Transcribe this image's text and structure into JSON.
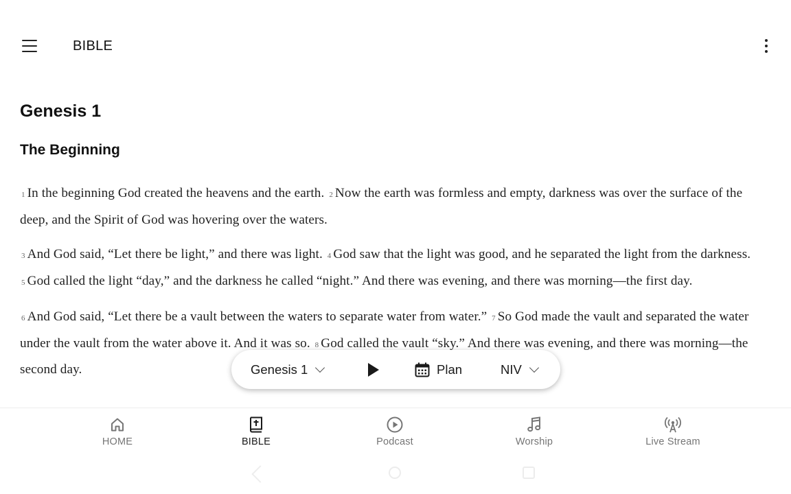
{
  "appbar": {
    "title": "BIBLE",
    "menu_icon": "hamburger-menu-icon",
    "more_icon": "more-vertical-icon"
  },
  "reader": {
    "chapter_title": "Genesis 1",
    "section_title": "The Beginning",
    "paragraphs": [
      [
        {
          "n": "1",
          "text": "In the beginning God created the heavens and the earth."
        },
        {
          "n": "2",
          "text": "Now the earth was formless and empty, darkness was over the surface of the deep, and the Spirit of God was hovering over the waters."
        }
      ],
      [
        {
          "n": "3",
          "text": "And God said, “Let there be light,” and there was light."
        },
        {
          "n": "4",
          "text": "God saw that the light was good, and he separated the light from the darkness."
        },
        {
          "n": "5",
          "text": "God called the light “day,” and the darkness he called “night.” And there was evening, and there was morning—the first day."
        }
      ],
      [
        {
          "n": "6",
          "text": "And God said, “Let there be a vault between the waters to separate water from water.”"
        },
        {
          "n": "7",
          "text": "So God made the vault and separated the water under the vault from the water above it. And it was so."
        },
        {
          "n": "8",
          "text": "God called the vault “sky.” And there was evening, and there was morning—the second day."
        }
      ]
    ]
  },
  "controls": {
    "book_label": "Genesis 1",
    "play_icon": "play-icon",
    "plan_label": "Plan",
    "plan_icon": "calendar-icon",
    "version_label": "NIV"
  },
  "bottom_nav": {
    "items": [
      {
        "label": "HOME",
        "icon": "home-icon",
        "active": false
      },
      {
        "label": "BIBLE",
        "icon": "bible-icon",
        "active": true
      },
      {
        "label": "Podcast",
        "icon": "podcast-play-icon",
        "active": false
      },
      {
        "label": "Worship",
        "icon": "music-note-icon",
        "active": false
      },
      {
        "label": "Live Stream",
        "icon": "broadcast-icon",
        "active": false
      }
    ]
  },
  "colors": {
    "text_primary": "#1a1a1a",
    "nav_inactive": "#757575",
    "background": "#ffffff"
  }
}
